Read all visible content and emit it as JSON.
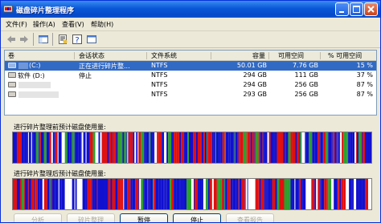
{
  "window": {
    "title": "磁盘碎片整理程序"
  },
  "menu": {
    "items": [
      "文件(F)",
      "操作(A)",
      "查看(V)",
      "帮助(H)"
    ]
  },
  "table": {
    "columns": [
      "卷",
      "会话状态",
      "文件系统",
      "容量",
      "可用空间",
      "% 可用空间"
    ],
    "rows": [
      {
        "volume": "(C:)",
        "status": "正在进行碎片整...",
        "fs": "NTFS",
        "capacity": "50.01 GB",
        "free": "7.76 GB",
        "pct": "15 %"
      },
      {
        "volume": "软件 (D:)",
        "status": "停止",
        "fs": "NTFS",
        "capacity": "294 GB",
        "free": "111 GB",
        "pct": "37 %"
      },
      {
        "volume": "",
        "status": "",
        "fs": "NTFS",
        "capacity": "294 GB",
        "free": "256 GB",
        "pct": "87 %"
      },
      {
        "volume": "",
        "status": "",
        "fs": "NTFS",
        "capacity": "293 GB",
        "free": "256 GB",
        "pct": "87 %"
      }
    ]
  },
  "analysis": {
    "before_label": "进行碎片整理前预计磁盘使用量:",
    "after_label": "进行碎片整理后预计磁盘使用量:",
    "colors": {
      "fragmented": "#e01010",
      "contiguous": "#1010d0",
      "unmovable": "#2ca02c",
      "free": "#ffffff"
    }
  },
  "buttons": {
    "analyze": "分析",
    "defrag": "碎片整理",
    "pause": "暂停",
    "stop": "停止",
    "report": "查看报告"
  }
}
